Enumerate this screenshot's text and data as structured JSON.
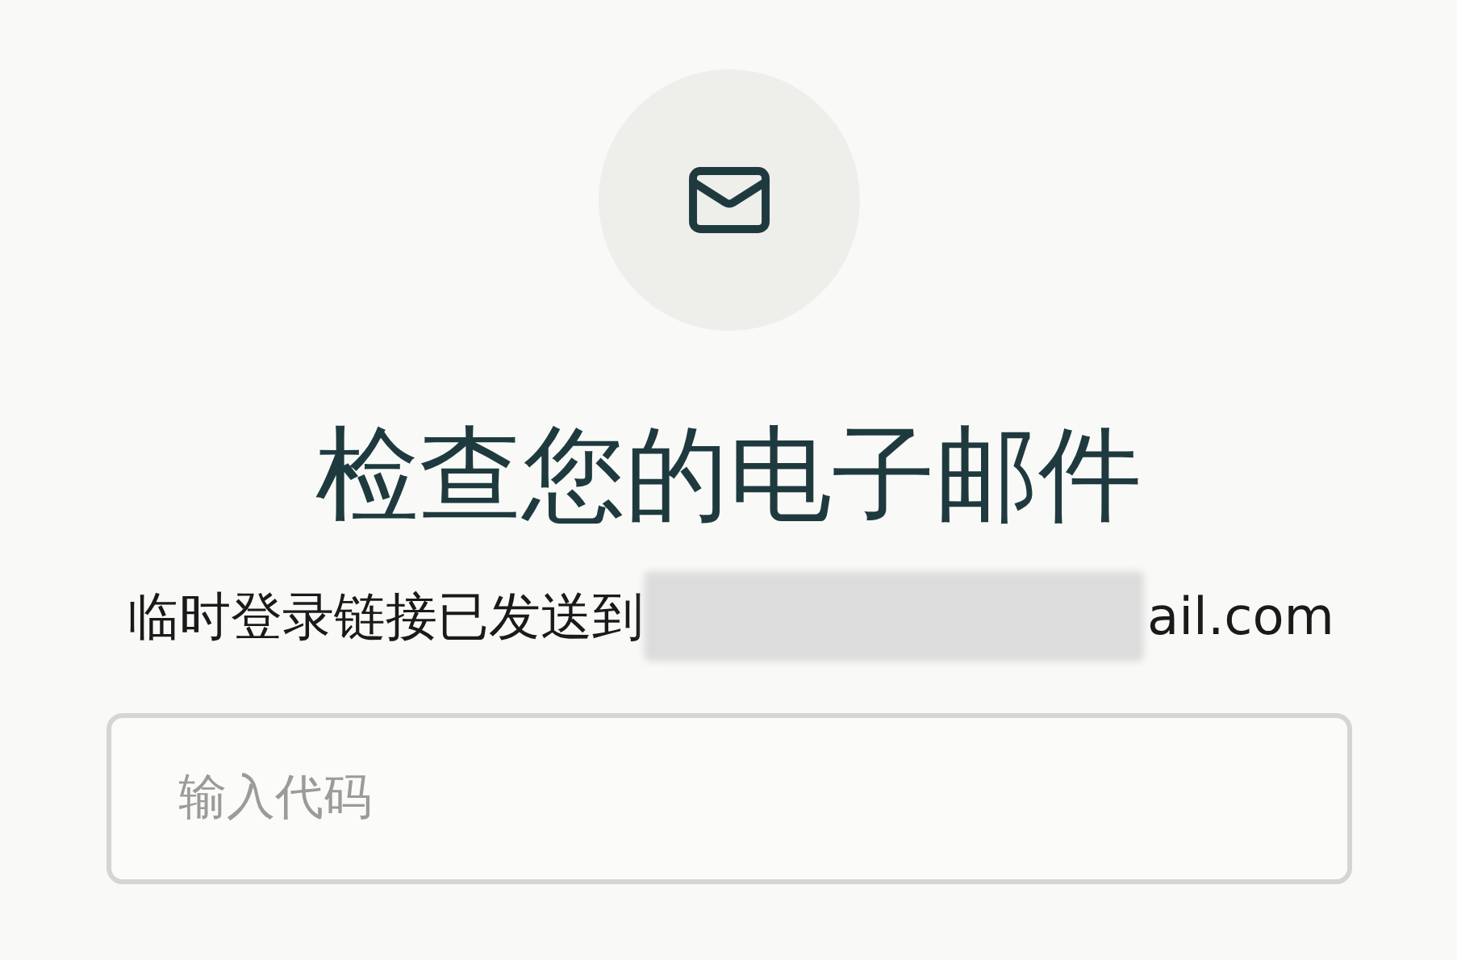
{
  "icon_circle": {
    "kind": "mail"
  },
  "heading": "检查您的电子邮件",
  "message": {
    "text": "临时登录链接已发送到",
    "email_tail": "ail.com"
  },
  "code_field": {
    "placeholder": "输入代码"
  }
}
